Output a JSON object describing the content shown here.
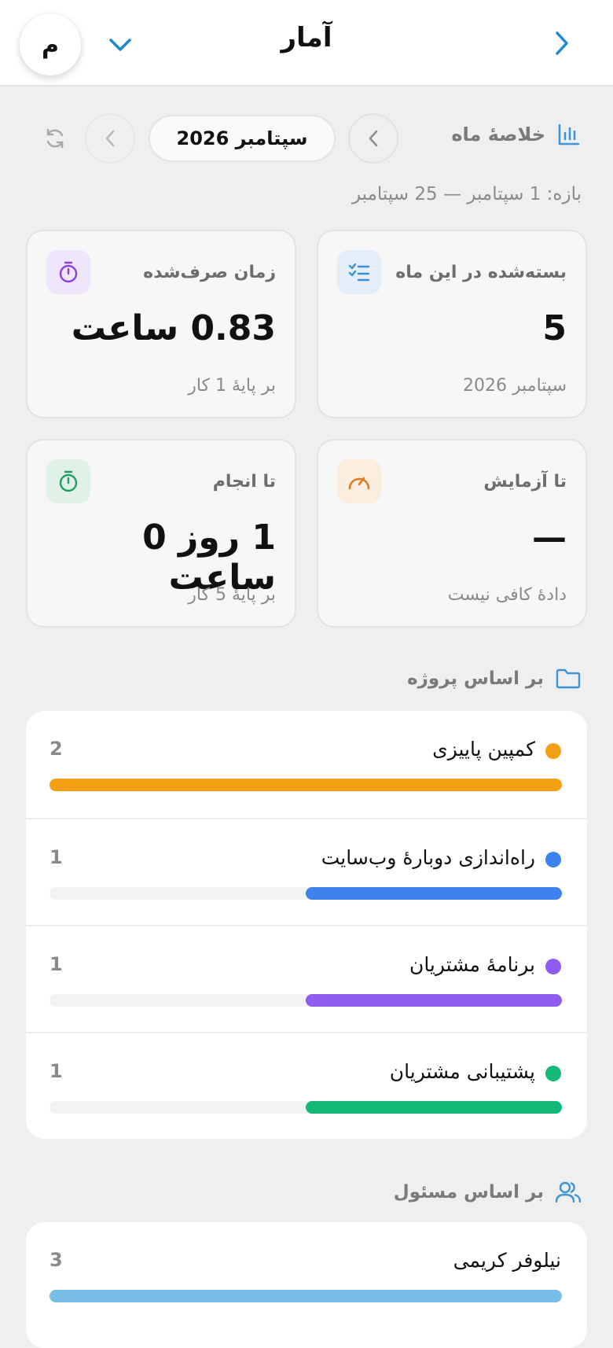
{
  "header": {
    "title": "آمار",
    "avatar_letter": "م",
    "back_icon": "chevron-right-icon",
    "menu_icon": "chevron-down-icon"
  },
  "summary": {
    "title": "خلاصهٔ ماه",
    "month": "سپتامبر 2026",
    "range": "بازه: 1 سپتامبر — 25 سپتامبر"
  },
  "cards": [
    {
      "label": "بسته‌شده در این ماه",
      "value": "5",
      "sub": "سپتامبر 2026",
      "icon": "checklist-icon",
      "color": "#3b8fd9",
      "bg": "#e3eef9"
    },
    {
      "label": "زمان صرف‌شده",
      "value": "0.83 ساعت",
      "sub": "بر پایهٔ 1 کار",
      "icon": "stopwatch-icon",
      "color": "#8b3fe0",
      "bg": "#efe6fb"
    },
    {
      "label": "تا آزمایش",
      "value": "—",
      "sub": "دادهٔ کافی نیست",
      "icon": "gauge-icon",
      "color": "#e07a1f",
      "bg": "#fbeede"
    },
    {
      "label": "تا انجام",
      "value": "1 روز 0 ساعت",
      "sub": "بر پایهٔ 5 کار",
      "icon": "timer-icon",
      "color": "#1f9d62",
      "bg": "#e0f2e8"
    }
  ],
  "projects": {
    "title": "بر اساس پروژه",
    "items": [
      {
        "name": "کمپین پاییزی",
        "count": "2",
        "fraction": 1.0,
        "color": "#f4a014"
      },
      {
        "name": "راه‌اندازی دوبارهٔ وب‌سایت",
        "count": "1",
        "fraction": 0.5,
        "color": "#3e82ef"
      },
      {
        "name": "برنامهٔ مشتریان",
        "count": "1",
        "fraction": 0.5,
        "color": "#8f5cf0"
      },
      {
        "name": "پشتیبانی مشتریان",
        "count": "1",
        "fraction": 0.5,
        "color": "#14b877"
      }
    ]
  },
  "assignees": {
    "title": "بر اساس مسئول",
    "items": [
      {
        "name": "نیلوفر کریمی",
        "count": "3",
        "fraction": 1.0,
        "color": "#7bbde9"
      }
    ]
  }
}
